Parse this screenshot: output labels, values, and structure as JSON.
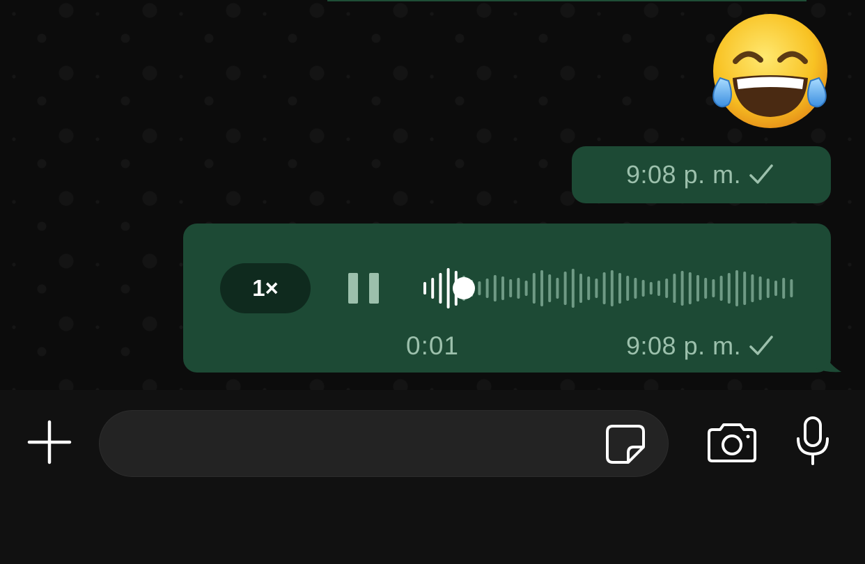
{
  "messages": [
    {
      "type": "emoji",
      "emoji_icon": "face-with-tears-of-joy-icon",
      "time": "9:08 p. m.",
      "status_icon": "single-check-icon"
    },
    {
      "type": "voice",
      "speed_label": "1×",
      "playback_state": "playing",
      "progress": 0.11,
      "elapsed": "0:01",
      "time": "9:08 p. m.",
      "status_icon": "single-check-icon"
    }
  ],
  "composer": {
    "placeholder": "",
    "value": "",
    "icons": [
      "plus-icon",
      "sticker-icon",
      "camera-icon",
      "microphone-icon"
    ]
  },
  "colors": {
    "bubble_outgoing": "#1d4a35",
    "meta_text": "#9cc0ac",
    "background": "#0c0c0c",
    "composer_bg": "#111111",
    "input_bg": "#232323"
  }
}
